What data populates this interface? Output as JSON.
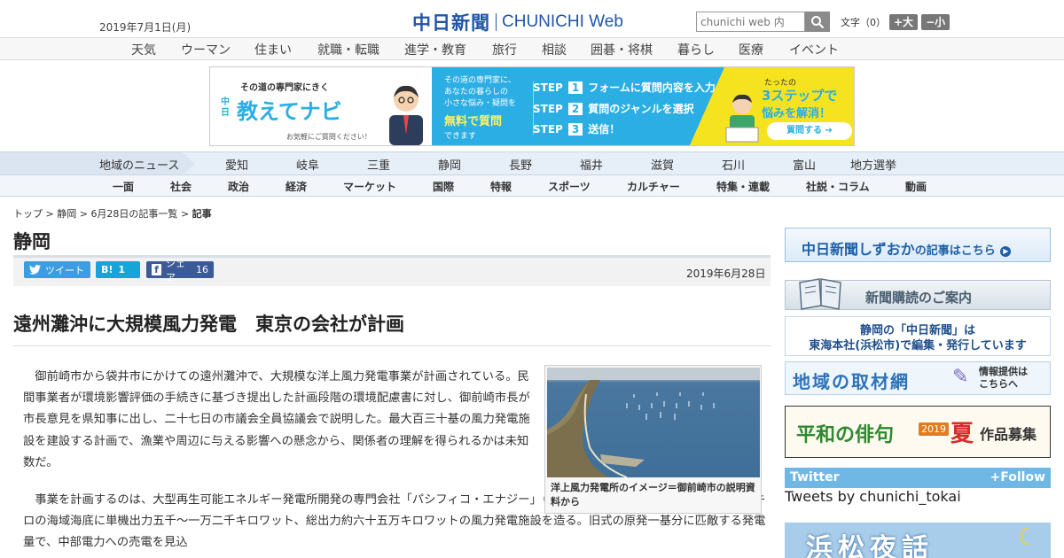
{
  "header": {
    "date": "2019年7月1日(月)",
    "logo_jp": "中日新聞",
    "logo_en_1": "CHUNICHI",
    "logo_en_2": "Web",
    "search_placeholder": "chunichi web 内",
    "fontsize_label": "文字（0）",
    "fontsize_larger": "+大",
    "fontsize_smaller": "−小"
  },
  "subnav": [
    "天気",
    "ウーマン",
    "住まい",
    "就職・転職",
    "進学・教育",
    "旅行",
    "相談",
    "囲碁・将棋",
    "暮らし",
    "医療",
    "イベント"
  ],
  "banner": {
    "tagline": "その道の専門家にきく",
    "brand_small": "中日",
    "brand": "教えてナビ",
    "note": "お気軽にご質問ください！",
    "mid_lines": [
      "その道の専門家に、",
      "あなたの暮らしの",
      "小さな悩み・疑問を"
    ],
    "free_label": "無料で質問",
    "can_label": "できます",
    "steps": [
      {
        "label": "STEP",
        "num": "1",
        "text": "フォームに質問内容を入力"
      },
      {
        "label": "STEP",
        "num": "2",
        "text": "質問のジャンルを選択"
      },
      {
        "label": "STEP",
        "num": "3",
        "text": "送信！"
      }
    ],
    "right_small": "たったの",
    "right_big": "3ステップで",
    "right_sub": "悩みを解消！",
    "cta": "質問する"
  },
  "region": {
    "label": "地域のニュース",
    "items": [
      "愛知",
      "岐阜",
      "三重",
      "静岡",
      "長野",
      "福井",
      "滋賀",
      "石川",
      "富山",
      "地方選挙"
    ]
  },
  "categories": [
    "一面",
    "社会",
    "政治",
    "経済",
    "マーケット",
    "国際",
    "特報",
    "スポーツ",
    "カルチャー",
    "特集・連載",
    "社説・コラム",
    "動画"
  ],
  "breadcrumb": {
    "top": "トップ",
    "sep": ">",
    "pref": "静岡",
    "list": "6月28日の記事一覧",
    "current": "記事"
  },
  "section_title": "静岡",
  "share": {
    "tweet": "ツイート",
    "hatena": "B!",
    "hatena_count": "1",
    "share": "シェア",
    "share_count": "16"
  },
  "article": {
    "date": "2019年6月28日",
    "headline": "遠州灘沖に大規模風力発電　東京の会社が計画",
    "para1": "御前崎市から袋井市にかけての遠州灘沖で、大規模な洋上風力発電事業が計画されている。民間事業者が環境影響評価の手続きに基づき提出した計画段階の環境配慮書に対し、御前崎市長が市長意見を県知事に出し、二十七日の市議会全員協議会で説明した。最大百三十基の風力発電施設を建設する計画で、漁業や周辺に与える影響への懸念から、関係者の理解を得られるかは未知数だ。",
    "para2": "事業を計画するのは、大型再生可能エネルギー発電所開発の専門会社「パシフィコ・エナジー」（東京）。遠州灘の沖合五百メートル～十キロの海域海底に単機出力五千～一万二千キロワット、総出力約六十五万キロワットの風力発電施設を造る。旧式の原発一基分に匹敵する発電量で、中部電力への売電を見込",
    "photo_caption": "洋上風力発電所のイメージ＝御前崎市の説明資料から"
  },
  "sidebar": {
    "shizuoka_title": "中日新聞しずおか",
    "shizuoka_suffix": "の記事はこちら",
    "subscribe": "新聞購読のご案内",
    "hq_line1": "静岡の「中日新聞」は",
    "hq_line2": "東海本社(浜松市)で編集・発行しています",
    "reporting": "地域の取材網",
    "reporting_sub1": "情報提供は",
    "reporting_sub2": "こちらへ",
    "haiku_title": "平和の俳句",
    "haiku_year": "2019",
    "haiku_season": "夏",
    "haiku_sub": "作品募集",
    "twitter_label": "Twitter",
    "twitter_follow": "Follow",
    "tweets_by": "Tweets by chunichi_tokai",
    "bottom_banner": "浜松夜話"
  },
  "colors": {
    "brand_blue": "#1f56a8",
    "banner_blue": "#2aaee4",
    "banner_yellow": "#f5e31f",
    "twitter": "#3c9ee0",
    "facebook": "#3b5a98"
  }
}
